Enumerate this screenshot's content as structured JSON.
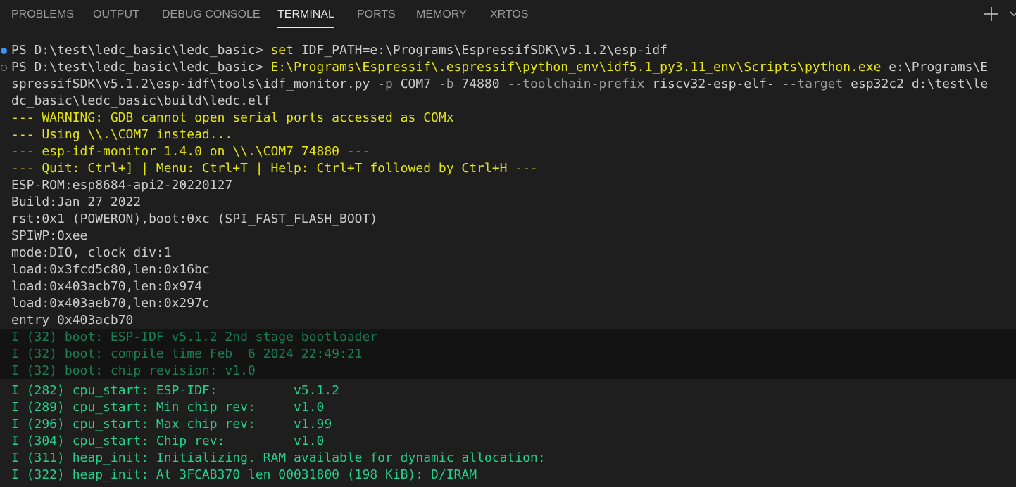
{
  "tabs": [
    {
      "label": "PROBLEMS"
    },
    {
      "label": "OUTPUT"
    },
    {
      "label": "DEBUG CONSOLE"
    },
    {
      "label": "TERMINAL",
      "active": true
    },
    {
      "label": "PORTS"
    },
    {
      "label": "MEMORY"
    },
    {
      "label": "XRTOS"
    }
  ],
  "toolbar": {
    "add_icon": "plus-icon"
  },
  "colors": {
    "background": "#1e1e1e",
    "yellow": "#e5e510",
    "green": "#23d18b",
    "text": "#cccccc",
    "marker_blue": "#3794ff"
  },
  "terminal": {
    "line1": {
      "prompt": "PS D:\\test\\ledc_basic\\ledc_basic> ",
      "cmd": "set",
      "rest": " IDF_PATH=e:\\Programs\\EspressifSDK\\v5.1.2\\esp-idf"
    },
    "line2": {
      "prompt": "PS D:\\test\\ledc_basic\\ledc_basic> ",
      "cmd": "E:\\Programs\\Espressif\\.espressif\\python_env\\idf5.1_py3.11_env\\Scripts\\python.exe",
      "rest": " e:\\Programs\\E"
    },
    "line3": {
      "a": "spressifSDK\\v5.1.2\\esp-idf\\tools\\idf_monitor.py ",
      "f1": "-p",
      "b": " COM7 ",
      "f2": "-b",
      "c": " 74880 ",
      "f3": "--toolchain-prefix",
      "d": " riscv32-esp-elf- ",
      "f4": "--target",
      "e": " esp32c2 d:\\test\\le"
    },
    "line4": "dc_basic\\ledc_basic\\build\\ledc.elf",
    "monitor": [
      "--- WARNING: GDB cannot open serial ports accessed as COMx",
      "--- Using \\\\.\\COM7 instead...",
      "--- esp-idf-monitor 1.4.0 on \\\\.\\COM7 74880 ---",
      "--- Quit: Ctrl+] | Menu: Ctrl+T | Help: Ctrl+T followed by Ctrl+H ---"
    ],
    "rom": [
      "ESP-ROM:esp8684-api2-20220127",
      "Build:Jan 27 2022",
      "rst:0x1 (POWERON),boot:0xc (SPI_FAST_FLASH_BOOT)",
      "SPIWP:0xee",
      "mode:DIO, clock div:1",
      "load:0x3fcd5c80,len:0x16bc",
      "load:0x403acb70,len:0x974",
      "load:0x403aeb70,len:0x297c",
      "entry 0x403acb70"
    ],
    "boot": [
      "I (32) boot: ESP-IDF v5.1.2 2nd stage bootloader",
      "I (32) boot: compile time Feb  6 2024 22:49:21",
      "I (32) boot: chip revision: v1.0"
    ],
    "app": [
      "I (282) cpu_start: ESP-IDF:          v5.1.2",
      "I (289) cpu_start: Min chip rev:     v1.0",
      "I (296) cpu_start: Max chip rev:     v1.99",
      "I (304) cpu_start: Chip rev:         v1.0",
      "I (311) heap_init: Initializing. RAM available for dynamic allocation:",
      "I (322) heap_init: At 3FCAB370 len 00031800 (198 KiB): D/IRAM"
    ]
  }
}
